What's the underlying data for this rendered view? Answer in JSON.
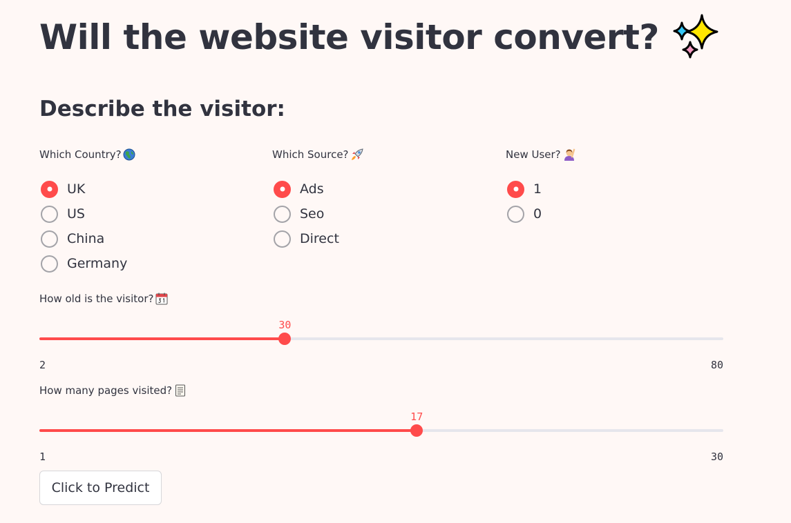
{
  "title": "Will the website visitor convert?",
  "title_emoji": "sparkles-icon",
  "subtitle": "Describe the visitor:",
  "country": {
    "label": "Which Country?",
    "icon": "globe-icon",
    "options": [
      "UK",
      "US",
      "China",
      "Germany"
    ],
    "selected": "UK"
  },
  "source": {
    "label": "Which Source?",
    "icon": "rocket-icon",
    "options": [
      "Ads",
      "Seo",
      "Direct"
    ],
    "selected": "Ads"
  },
  "new_user": {
    "label": "New User?",
    "icon": "raising-hand-icon",
    "options": [
      "1",
      "0"
    ],
    "selected": "1"
  },
  "age_slider": {
    "label": "How old is the visitor?",
    "icon": "calendar-icon",
    "value": 30,
    "min": 2,
    "max": 80
  },
  "pages_slider": {
    "label": "How many pages visited?",
    "icon": "scroll-icon",
    "value": 17,
    "min": 1,
    "max": 30
  },
  "predict_button": {
    "label": "Click to Predict"
  },
  "colors": {
    "accent": "#ff4b4b",
    "background": "#fff8f6",
    "text": "#31333f",
    "track": "#e6e6ec"
  }
}
